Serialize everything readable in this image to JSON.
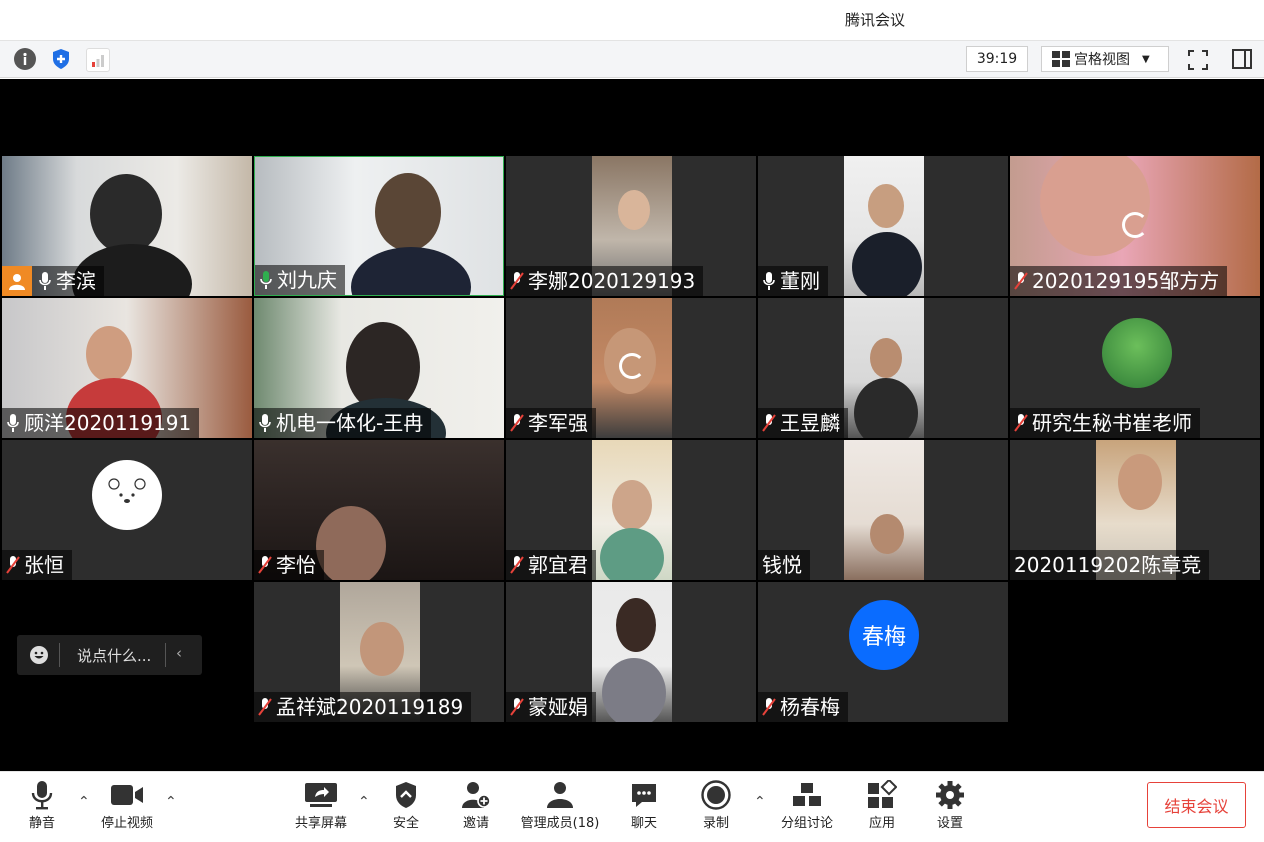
{
  "app_title": "腾讯会议",
  "toolbar": {
    "timer": "39:19",
    "view_label": "宫格视图"
  },
  "participants": [
    {
      "name": "李滨",
      "mic": "on",
      "host": true
    },
    {
      "name": "刘九庆",
      "mic": "on-green"
    },
    {
      "name": "李娜2020129193",
      "mic": "muted"
    },
    {
      "name": "董刚",
      "mic": "on"
    },
    {
      "name": "2020129195邹方方",
      "mic": "muted"
    },
    {
      "name": "顾洋2020119191",
      "mic": "on"
    },
    {
      "name": "机电一体化-王冉",
      "mic": "on"
    },
    {
      "name": "李军强",
      "mic": "muted"
    },
    {
      "name": "王昱麟",
      "mic": "muted"
    },
    {
      "name": "研究生秘书崔老师",
      "mic": "muted"
    },
    {
      "name": "张恒",
      "mic": "muted"
    },
    {
      "name": "李怡",
      "mic": "muted"
    },
    {
      "name": "郭宜君",
      "mic": "muted"
    },
    {
      "name": "钱悦",
      "mic": "none"
    },
    {
      "name": "2020119202陈章竞",
      "mic": "none"
    },
    {
      "name": "孟祥斌2020119189",
      "mic": "muted"
    },
    {
      "name": "蒙娅娟",
      "mic": "muted"
    },
    {
      "name": "杨春梅",
      "mic": "muted"
    }
  ],
  "avatar_text": {
    "yang": "春梅"
  },
  "chat": {
    "placeholder": "说点什么..."
  },
  "bottom": {
    "mute": "静音",
    "stop_video": "停止视频",
    "share": "共享屏幕",
    "security": "安全",
    "invite": "邀请",
    "members": "管理成员(18)",
    "chat": "聊天",
    "record": "录制",
    "breakout": "分组讨论",
    "apps": "应用",
    "settings": "设置",
    "end": "结束会议"
  },
  "colors": {
    "accent_blue": "#0a6cff",
    "end_red": "#e6423a",
    "active_green": "#2fae4f"
  }
}
